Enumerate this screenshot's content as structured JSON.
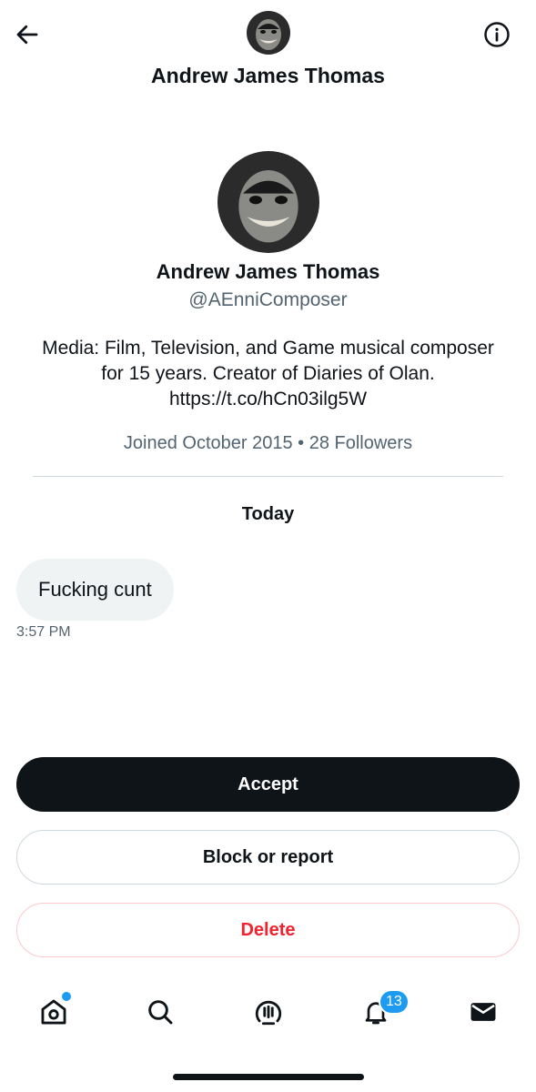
{
  "header": {
    "title": "Andrew James Thomas",
    "back_icon": "arrow-left-icon",
    "info_icon": "info-icon"
  },
  "profile": {
    "name": "Andrew James Thomas",
    "handle": "@AEnniComposer",
    "bio": "Media: Film, Television, and Game musical composer for 15 years. Creator of Diaries of Olan. https://t.co/hCn03ilg5W",
    "meta": "Joined October 2015 • 28 Followers"
  },
  "conversation": {
    "date_separator": "Today",
    "messages": [
      {
        "text": "Fucking cunt",
        "time": "3:57 PM"
      }
    ]
  },
  "actions": {
    "accept": "Accept",
    "block": "Block or report",
    "delete": "Delete"
  },
  "bottom_nav": {
    "items": [
      {
        "icon": "home-icon",
        "has_dot": true
      },
      {
        "icon": "search-icon"
      },
      {
        "icon": "spaces-icon"
      },
      {
        "icon": "bell-icon",
        "badge": "13"
      },
      {
        "icon": "mail-icon"
      }
    ]
  },
  "colors": {
    "text": "#0f1419",
    "secondary": "#536471",
    "accent": "#1d9bf0",
    "danger": "#f4212e",
    "bubble": "#eff3f4"
  }
}
